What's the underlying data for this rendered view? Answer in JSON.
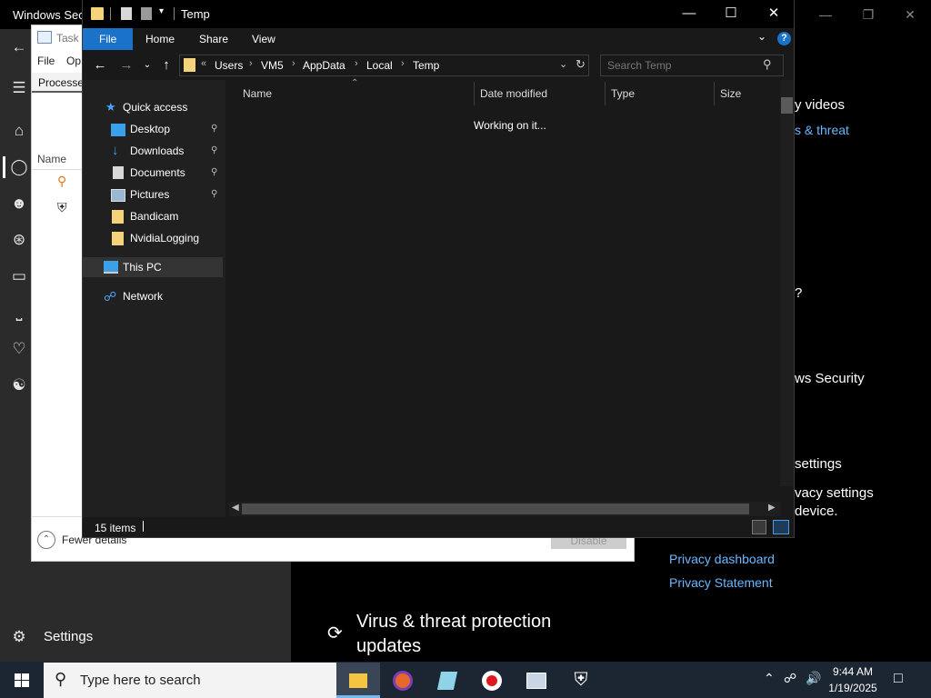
{
  "windows_security": {
    "title": "Windows Secu",
    "settings_label": "Settings",
    "partial_text": {
      "videos": "y videos",
      "threat": "s & threat",
      "question": "?",
      "ws_security": "ws Security",
      "settings": "settings",
      "privacy_settings": "vacy settings",
      "device": "device."
    },
    "privacy_dashboard": "Privacy dashboard",
    "privacy_statement": "Privacy Statement",
    "virus_title_line1": "Virus & threat protection",
    "virus_title_line2": "updates",
    "nav_icons": [
      "back-arrow-icon",
      "hamburger-icon",
      "home-icon",
      "shield-icon",
      "person-icon",
      "wireless-icon",
      "app-browser-icon",
      "device-icon",
      "health-heart-icon",
      "family-icon",
      "gear-icon"
    ]
  },
  "task_manager": {
    "title": "Task",
    "menu": {
      "file": "File",
      "options": "Op"
    },
    "tab_processes": "Processe",
    "column_name": "Name",
    "fewer_details": "Fewer details",
    "disable": "Disable"
  },
  "explorer": {
    "title": "Temp",
    "ribbon": {
      "file": "File",
      "home": "Home",
      "share": "Share",
      "view": "View"
    },
    "breadcrumb": [
      "Users",
      "VM5",
      "AppData",
      "Local",
      "Temp"
    ],
    "breadcrumb_overflow": "«",
    "search_placeholder": "Search Temp",
    "nav": {
      "quick_access": "Quick access",
      "desktop": "Desktop",
      "downloads": "Downloads",
      "documents": "Documents",
      "pictures": "Pictures",
      "bandicam": "Bandicam",
      "nvidia": "NvidiaLogging",
      "this_pc": "This PC",
      "network": "Network"
    },
    "columns": {
      "name": "Name",
      "date": "Date modified",
      "type": "Type",
      "size": "Size"
    },
    "status_message": "Working on it...",
    "item_count": "15 items"
  },
  "taskbar": {
    "search_placeholder": "Type here to search",
    "time": "9:44 AM",
    "date": "1/19/2025",
    "apps": [
      "file-explorer-icon",
      "firefox-icon",
      "notepad-icon",
      "record-icon",
      "paint-icon",
      "windows-security-icon"
    ]
  },
  "colors": {
    "accent": "#1a73c9",
    "link": "#6bb8ff",
    "explorer_bg": "#191919",
    "taskbar_bg": "#1c2633"
  }
}
